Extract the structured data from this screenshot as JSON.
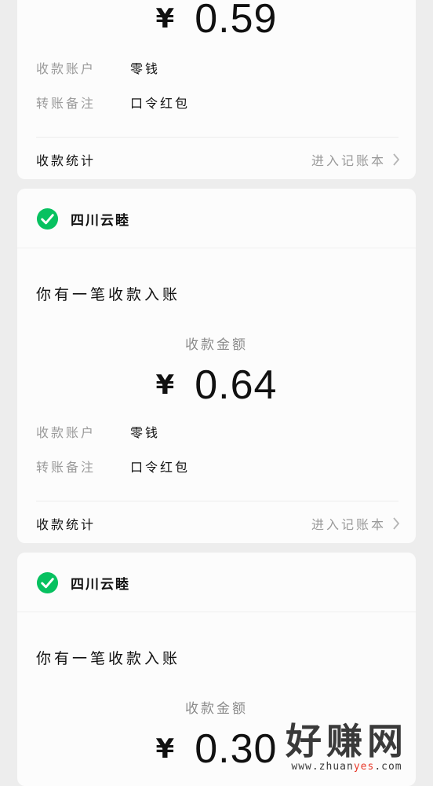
{
  "cards": [
    {
      "amount_currency": "¥",
      "amount_value": "0.59",
      "account_label": "收款账户",
      "account_value": "零钱",
      "note_label": "转账备注",
      "note_value": "口令红包",
      "stats_label": "收款统计",
      "stats_link": "进入记账本"
    },
    {
      "sender": "四川云睦",
      "headline": "你有一笔收款入账",
      "amount_label": "收款金额",
      "amount_currency": "¥",
      "amount_value": "0.64",
      "account_label": "收款账户",
      "account_value": "零钱",
      "note_label": "转账备注",
      "note_value": "口令红包",
      "stats_label": "收款统计",
      "stats_link": "进入记账本"
    },
    {
      "sender": "四川云睦",
      "headline": "你有一笔收款入账",
      "amount_label": "收款金额",
      "amount_currency": "¥",
      "amount_value": "0.30"
    }
  ],
  "watermark": {
    "cn": "好赚网",
    "url_prefix": "www.zhuan",
    "url_highlight": "yes",
    "url_suffix": ".com"
  },
  "colors": {
    "check_green": "#07c160",
    "background": "#ededed",
    "card": "#fcfcfc"
  },
  "icons": [
    "check-circle-icon",
    "chevron-right-icon"
  ]
}
